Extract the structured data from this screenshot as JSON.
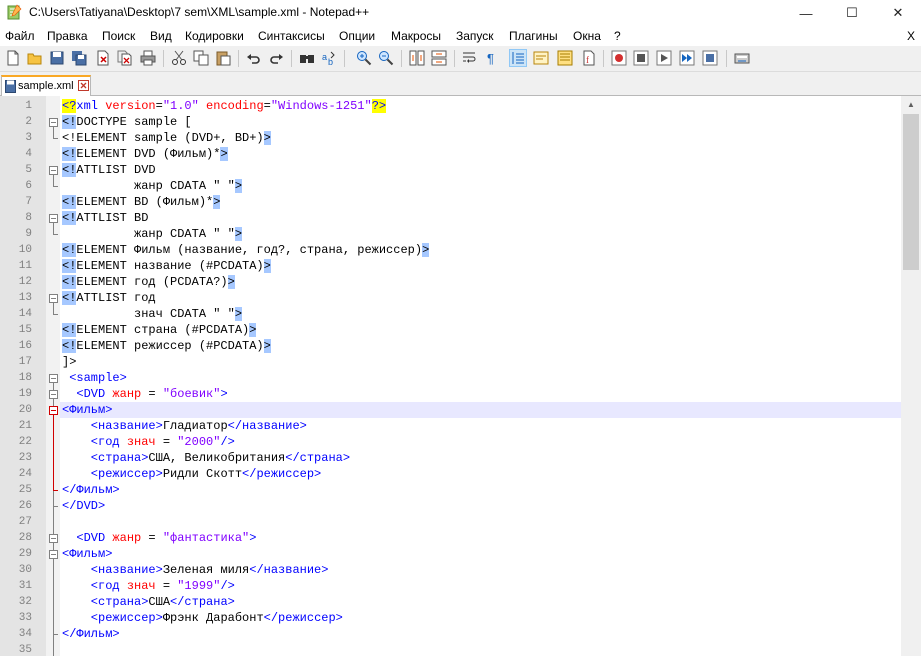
{
  "window": {
    "title": "C:\\Users\\Tatiyana\\Desktop\\7 sem\\XML\\sample.xml - Notepad++",
    "minimize": "—",
    "maximize": "☐",
    "close": "✕"
  },
  "menu": {
    "items": [
      "Файл",
      "Правка",
      "Поиск",
      "Вид",
      "Кодировки",
      "Синтаксисы",
      "Опции",
      "Макросы",
      "Запуск",
      "Плагины",
      "Окна",
      "?"
    ],
    "close_doc": "X"
  },
  "toolbar": {
    "icons": [
      "new-file-icon",
      "open-file-icon",
      "save-icon",
      "save-all-icon",
      "close-icon",
      "close-all-icon",
      "print-icon",
      "cut-icon",
      "copy-icon",
      "paste-icon",
      "undo-icon",
      "redo-icon",
      "find-icon",
      "replace-icon",
      "zoom-in-icon",
      "zoom-out-icon",
      "sync-v-icon",
      "sync-h-icon",
      "word-wrap-icon",
      "all-chars-icon",
      "indent-guide-icon",
      "udl-icon",
      "doc-map-icon",
      "function-list-icon",
      "folder-workspace-icon",
      "record-macro-icon",
      "stop-macro-icon",
      "play-macro-icon",
      "play-multi-icon",
      "save-macro-icon",
      "spell-check-icon"
    ]
  },
  "tab": {
    "label": "sample.xml"
  },
  "editor": {
    "current_line": 20,
    "colors": {
      "tag": "#0000ff",
      "attr": "#ff0000",
      "value": "#8000ff",
      "current_line_bg": "#e8e8ff"
    },
    "lines": [
      {
        "n": "1"
      },
      {
        "n": "2"
      },
      {
        "n": "3"
      },
      {
        "n": "4"
      },
      {
        "n": "5"
      },
      {
        "n": "6"
      },
      {
        "n": "7"
      },
      {
        "n": "8"
      },
      {
        "n": "9"
      },
      {
        "n": "10"
      },
      {
        "n": "11"
      },
      {
        "n": "12"
      },
      {
        "n": "13"
      },
      {
        "n": "14"
      },
      {
        "n": "15"
      },
      {
        "n": "16"
      },
      {
        "n": "17"
      },
      {
        "n": "18"
      },
      {
        "n": "19"
      },
      {
        "n": "20"
      },
      {
        "n": "21"
      },
      {
        "n": "22"
      },
      {
        "n": "23"
      },
      {
        "n": "24"
      },
      {
        "n": "25"
      },
      {
        "n": "26"
      },
      {
        "n": "27"
      },
      {
        "n": "28"
      },
      {
        "n": "29"
      },
      {
        "n": "30"
      },
      {
        "n": "31"
      },
      {
        "n": "32"
      },
      {
        "n": "33"
      },
      {
        "n": "34"
      },
      {
        "n": "35"
      }
    ],
    "code": {
      "l1_a": "<?",
      "l1_b": "xml",
      "l1_c": " version",
      "l1_d": "=",
      "l1_e": "\"1.0\"",
      "l1_f": " encoding",
      "l1_g": "=",
      "l1_h": "\"Windows-1251\"",
      "l1_i": "?>",
      "l2_a": "<!",
      "l2_b": "DOCTYPE sample [",
      "l3_a": "<!ELEMENT sample (DVD+, BD+)",
      "l3_b": ">",
      "l4_a": "<!",
      "l4_b": "ELEMENT DVD (Фильм)*",
      "l4_c": ">",
      "l5_a": "<!",
      "l5_b": "ATTLIST DVD",
      "l6_a": "          жанр CDATA \" \"",
      "l6_b": ">",
      "l7_a": "<!",
      "l7_b": "ELEMENT BD (Фильм)*",
      "l7_c": ">",
      "l8_a": "<!",
      "l8_b": "ATTLIST BD",
      "l9_a": "          жанр CDATA \" \"",
      "l9_b": ">",
      "l10_a": "<!",
      "l10_b": "ELEMENT Фильм (название, год?, страна, режиссер)",
      "l10_c": ">",
      "l11_a": "<!",
      "l11_b": "ELEMENT название (#PCDATA)",
      "l11_c": ">",
      "l12_a": "<!",
      "l12_b": "ELEMENT год (PCDATA?)",
      "l12_c": ">",
      "l13_a": "<!",
      "l13_b": "ATTLIST год",
      "l14_a": "          знач CDATA \" \"",
      "l14_b": ">",
      "l15_a": "<!",
      "l15_b": "ELEMENT страна (#PCDATA)",
      "l15_c": ">",
      "l16_a": "<!",
      "l16_b": "ELEMENT режиссер (#PCDATA)",
      "l16_c": ">",
      "l17_a": "]>",
      "l18_a": " <sample>",
      "l19_a": "  <DVD ",
      "l19_b": "жанр",
      "l19_c": " = ",
      "l19_d": "\"боевик\"",
      "l19_e": ">",
      "l20_a": "<Фильм>",
      "l21_a": "    <название>",
      "l21_b": "Гладиатор",
      "l21_c": "</название>",
      "l22_a": "    <год ",
      "l22_b": "знач",
      "l22_c": " = ",
      "l22_d": "\"2000\"",
      "l22_e": "/>",
      "l23_a": "    <страна>",
      "l23_b": "США, Великобритания",
      "l23_c": "</страна>",
      "l24_a": "    <режиссер>",
      "l24_b": "Ридли Скотт",
      "l24_c": "</режиссер>",
      "l25_a": "</Фильм>",
      "l26_a": "</DVD>",
      "l28_a": "  <DVD ",
      "l28_b": "жанр",
      "l28_c": " = ",
      "l28_d": "\"фантастика\"",
      "l28_e": ">",
      "l29_a": "<Фильм>",
      "l30_a": "    <название>",
      "l30_b": "Зеленая миля",
      "l30_c": "</название>",
      "l31_a": "    <год ",
      "l31_b": "знач",
      "l31_c": " = ",
      "l31_d": "\"1999\"",
      "l31_e": "/>",
      "l32_a": "    <страна>",
      "l32_b": "США",
      "l32_c": "</страна>",
      "l33_a": "    <режиссер>",
      "l33_b": "Фрэнк Дарабонт",
      "l33_c": "</режиссер>",
      "l34_a": "</Фильм>"
    }
  }
}
